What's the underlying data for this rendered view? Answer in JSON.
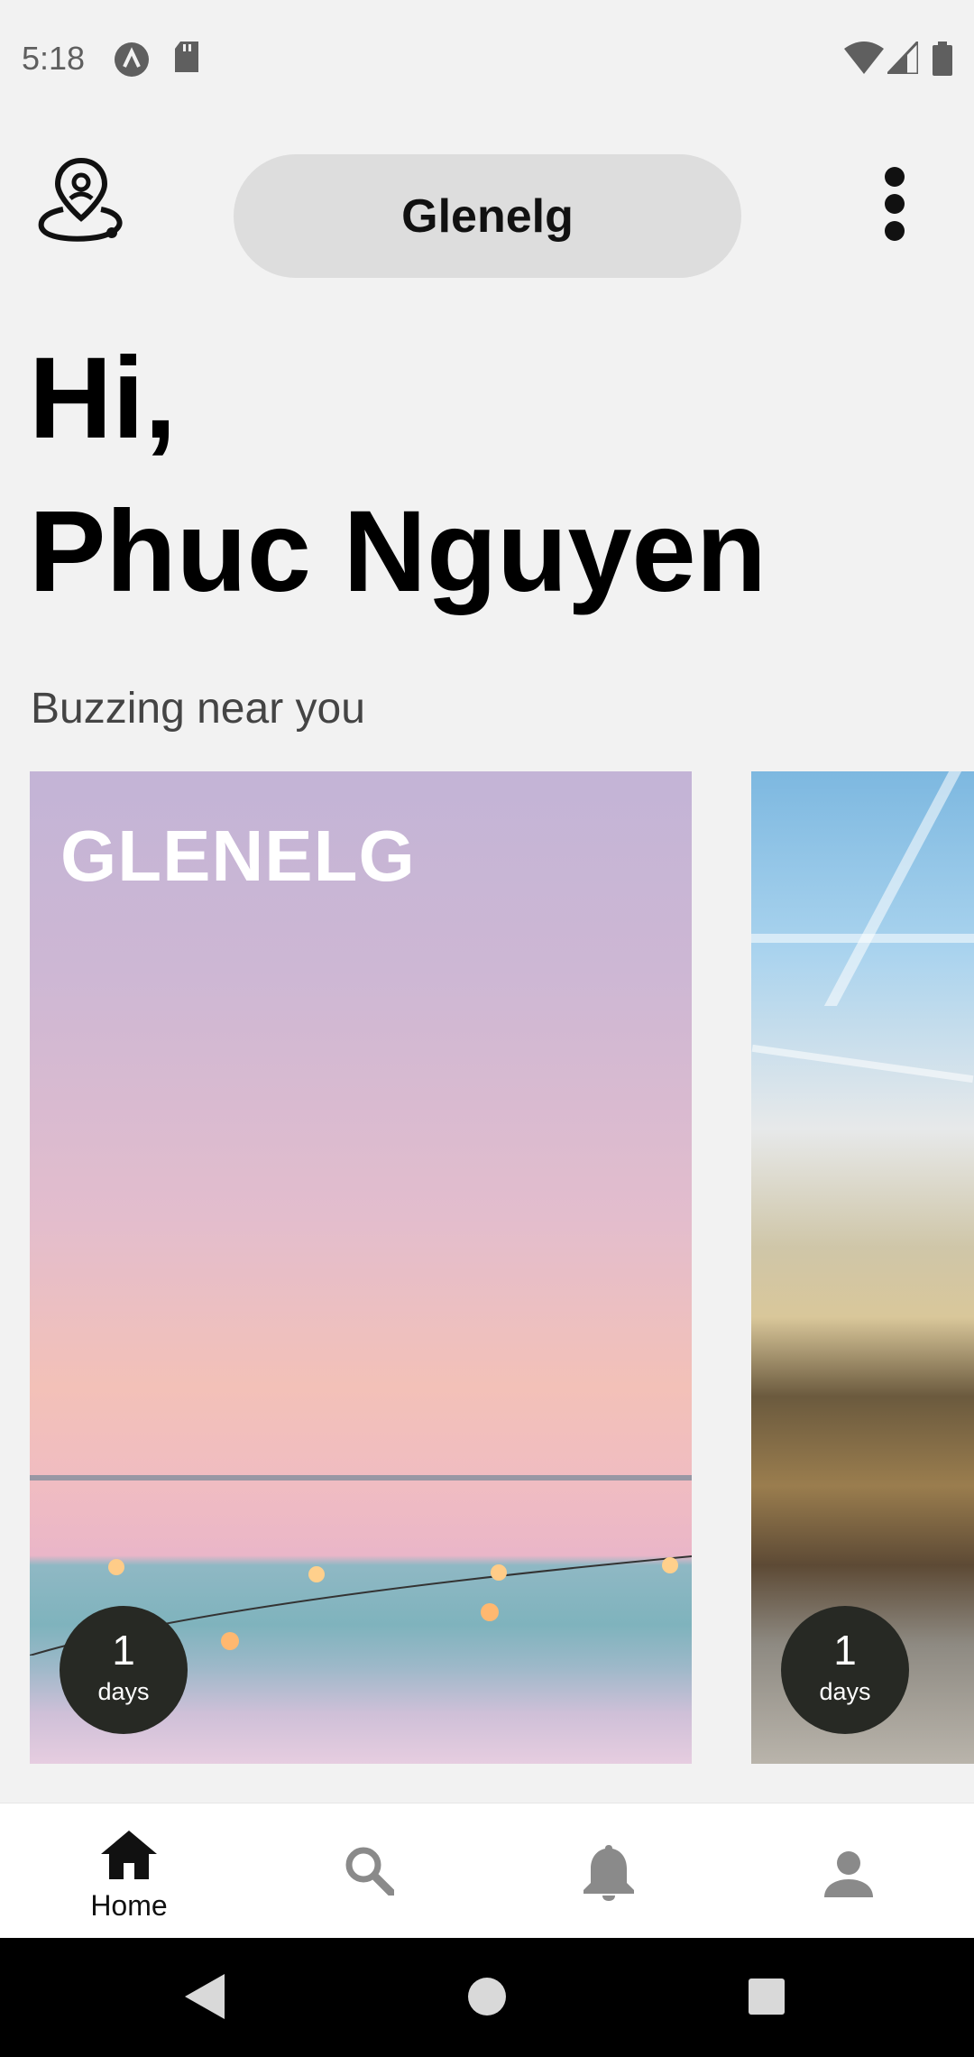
{
  "status_bar": {
    "time": "5:18",
    "left_icons": [
      "app-notification-icon",
      "sd-card-icon"
    ],
    "right_icons": [
      "wifi-icon",
      "cellular-signal-icon",
      "battery-icon"
    ]
  },
  "app_bar": {
    "logo_icon": "location-person-icon",
    "location_label": "Glenelg",
    "menu_icon": "more-vertical-icon"
  },
  "greeting": {
    "line1": "Hi,",
    "line2": "Phuc Nguyen"
  },
  "section": {
    "title": "Buzzing near you"
  },
  "cards": [
    {
      "title": "GLENELG",
      "count": "1",
      "unit": "days"
    },
    {
      "title": "",
      "count": "1",
      "unit": "days"
    }
  ],
  "bottom_nav": [
    {
      "label": "Home",
      "icon": "home-icon",
      "active": true
    },
    {
      "label": "",
      "icon": "search-icon",
      "active": false
    },
    {
      "label": "",
      "icon": "bell-icon",
      "active": false
    },
    {
      "label": "",
      "icon": "person-icon",
      "active": false
    }
  ],
  "system_nav": [
    "back-icon",
    "home-circle-icon",
    "recents-icon"
  ],
  "colors": {
    "background": "#f2f2f2",
    "pill": "#dddddd",
    "badge": "#272924",
    "active_nav": "#111111",
    "inactive_nav": "#8a8a8a"
  }
}
